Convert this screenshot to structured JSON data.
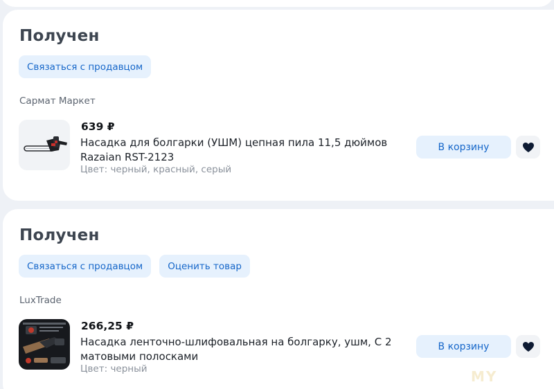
{
  "accent_color": "#1566c9",
  "chip_bg": "#e6f1fd",
  "orders": [
    {
      "status": "Получен",
      "buttons": [
        "Связаться с продавцом"
      ],
      "seller": "Сармат Маркет",
      "item": {
        "image": "chainsaw-attachment-image",
        "price": "639 ₽",
        "title_line1": "Насадка для болгарки (УШМ) цепная пила 11,5 дюймов",
        "title_line2": "Razaian RST-2123",
        "attributes": "Цвет: черный, красный, серый",
        "cart_label": "В корзину",
        "favorite_icon": "heart-icon"
      }
    },
    {
      "status": "Получен",
      "buttons": [
        "Связаться с продавцом",
        "Оценить товар"
      ],
      "seller": "LuxTrade",
      "item": {
        "image": "belt-sander-attachment-image",
        "price": "266,25 ₽",
        "title_line1": "Насадка ленточно-шлифовальная на болгарку, ушм, С 2",
        "title_line2": "матовыми полосками",
        "attributes": "Цвет: черный",
        "cart_label": "В корзину",
        "favorite_icon": "heart-icon"
      }
    }
  ],
  "watermark": "MY"
}
